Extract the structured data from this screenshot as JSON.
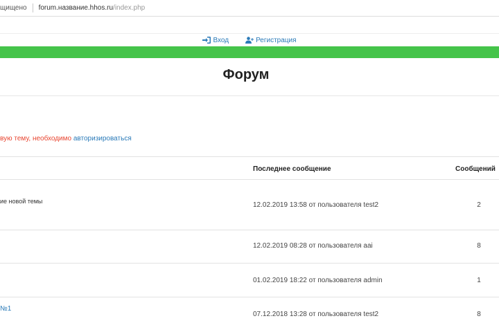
{
  "browser": {
    "secure_text": "щищено",
    "url_host": "forum.название.hhos.ru",
    "url_path": "/index.php"
  },
  "nav": {
    "login": "Вход",
    "register": "Регистрация"
  },
  "colors": {
    "accent_green": "#45c44a",
    "link_blue": "#2a7ab8",
    "notice_red": "#e8442f"
  },
  "page": {
    "title": "Форум",
    "notice_text": "вую тему, необходимо ",
    "notice_link": "авторизироваться"
  },
  "table": {
    "headers": {
      "last_message": "Последнее сообщение",
      "count": "Сообщений"
    },
    "rows": [
      {
        "topic": "ие новой темы",
        "last": "12.02.2019 13:58 от пользователя test2",
        "count": "2"
      },
      {
        "topic": "",
        "last": "12.02.2019 08:28 от пользователя aai",
        "count": "8"
      },
      {
        "topic": "",
        "last": "01.02.2019 18:22 от пользователя admin",
        "count": "1"
      },
      {
        "topic": "№1",
        "last": "07.12.2018 13:28 от пользователя test2",
        "count": "8"
      }
    ]
  }
}
